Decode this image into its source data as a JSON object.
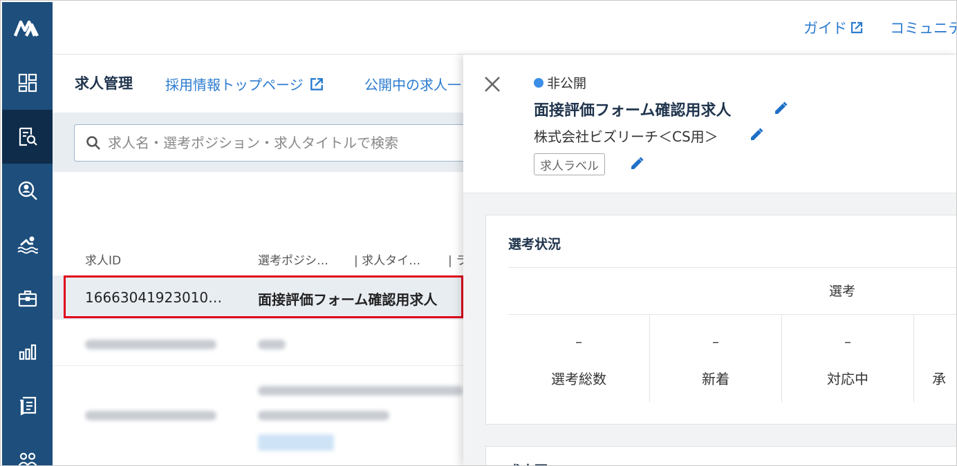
{
  "topbar": {
    "guide_label": "ガイド",
    "community_label": "コミュニテ"
  },
  "main": {
    "page_title": "求人管理",
    "link_recruit_top": "採用情報トップページ",
    "link_published": "公開中の求人一",
    "search_placeholder": "求人名・選考ポジション・求人タイトルで検索",
    "table": {
      "headers": [
        "求人ID",
        "選考ポジシ…",
        "| 求人タイ…",
        "| ラ"
      ],
      "selected_row": {
        "id": "16663041923010…",
        "position": "面接評価フォーム確認用求人"
      }
    }
  },
  "panel": {
    "status": "非公開",
    "job_title": "面接評価フォーム確認用求人",
    "company": "株式会社ビズリーチ＜CS用＞",
    "label_chip": "求人ラベル",
    "section_title": "選考状況",
    "selection_header": "選考",
    "stats": [
      {
        "value": "–",
        "label": "選考総数"
      },
      {
        "value": "–",
        "label": "新着"
      },
      {
        "value": "–",
        "label": "対応中"
      },
      {
        "value": "",
        "label": "承"
      }
    ],
    "next_section_title": "求人票"
  },
  "colors": {
    "sidebar": "#1d4e7c",
    "sidebar_active": "#0f2c4b",
    "link": "#2b7bd0",
    "highlight": "#e0001b",
    "status_dot": "#3a8ee6"
  },
  "icons": {
    "sidebar": [
      "logo-icon",
      "dashboard-icon",
      "job-doc-search-icon",
      "candidate-search-icon",
      "swimmer-icon",
      "briefcase-icon",
      "bar-chart-icon",
      "form-icon",
      "people-icon"
    ]
  }
}
